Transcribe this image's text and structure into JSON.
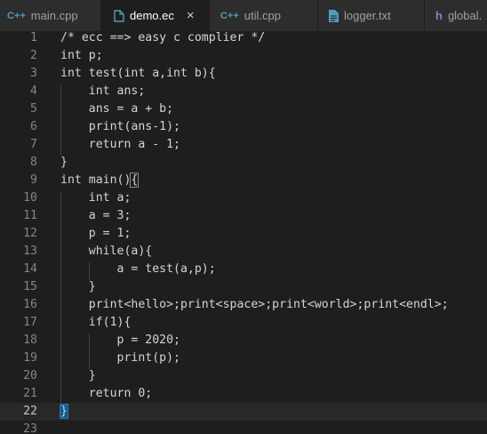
{
  "tabs": [
    {
      "label": "main.cpp",
      "icon": "cpp-file-icon",
      "glyph": "C++",
      "active": false
    },
    {
      "label": "demo.ec",
      "icon": "document-file-icon",
      "glyph": "",
      "active": true,
      "close": "×"
    },
    {
      "label": "util.cpp",
      "icon": "cpp-file-icon",
      "glyph": "C++",
      "active": false
    },
    {
      "label": "logger.txt",
      "icon": "text-file-icon",
      "glyph": "",
      "active": false
    },
    {
      "label": "global.",
      "icon": "header-file-icon",
      "glyph": "h",
      "active": false
    }
  ],
  "editor": {
    "current_line": 22,
    "lines": [
      "/* ecc ==> easy c complier */",
      "int p;",
      "int test(int a,int b){",
      "    int ans;",
      "    ans = a + b;",
      "    print(ans-1);",
      "    return a - 1;",
      "}",
      "int main(){",
      "    int a;",
      "    a = 3;",
      "    p = 1;",
      "    while(a){",
      "        a = test(a,p);",
      "    }",
      "    print<hello>;print<space>;print<world>;print<endl>;",
      "    if(1){",
      "        p = 2020;",
      "        print(p);",
      "    }",
      "    return 0;",
      "}",
      ""
    ],
    "line_numbers": [
      "1",
      "2",
      "3",
      "4",
      "5",
      "6",
      "7",
      "8",
      "9",
      "10",
      "11",
      "12",
      "13",
      "14",
      "15",
      "16",
      "17",
      "18",
      "19",
      "20",
      "21",
      "22",
      "23"
    ]
  },
  "colors": {
    "background": "#1e1e1e",
    "tabbar": "#252526",
    "text": "#d4d4d4",
    "line_number": "#858585"
  }
}
